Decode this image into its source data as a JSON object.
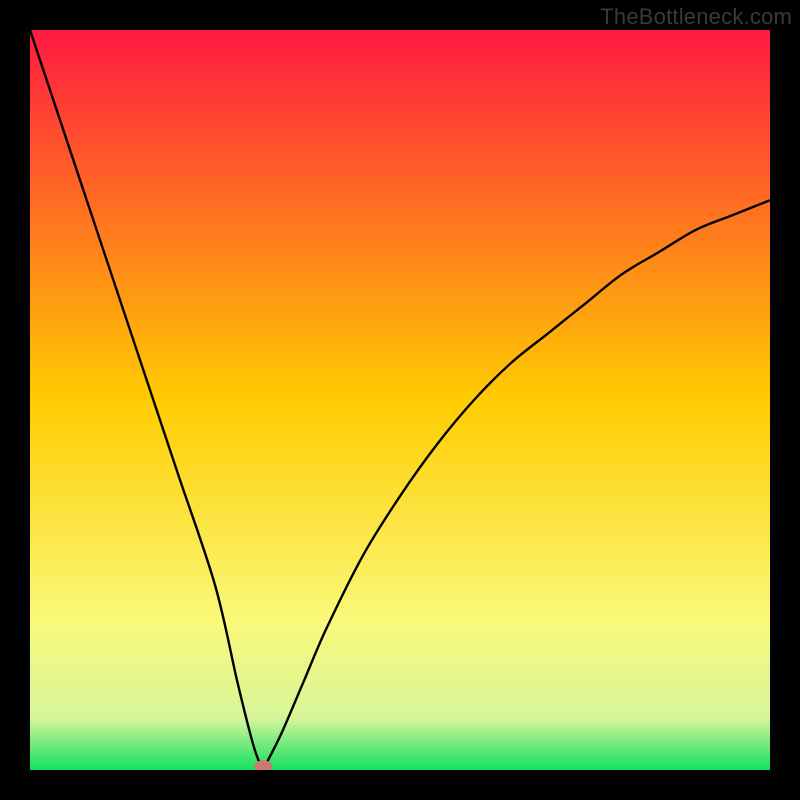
{
  "watermark": "TheBottleneck.com",
  "chart_data": {
    "type": "line",
    "title": "",
    "xlabel": "",
    "ylabel": "",
    "xlim": [
      0,
      100
    ],
    "ylim": [
      0,
      100
    ],
    "grid": false,
    "legend": false,
    "background_gradient": [
      {
        "stop": 0.0,
        "color": "#ff1a40"
      },
      {
        "stop": 0.5,
        "color": "#ffcc00"
      },
      {
        "stop": 0.8,
        "color": "#faf97a"
      },
      {
        "stop": 0.93,
        "color": "#d6f59a"
      },
      {
        "stop": 1.0,
        "color": "#15e060"
      }
    ],
    "series": [
      {
        "name": "bottleneck-curve",
        "x": [
          0,
          2,
          5,
          10,
          15,
          20,
          25,
          28,
          30,
          31,
          31.5,
          32,
          34,
          37,
          40,
          45,
          50,
          55,
          60,
          65,
          70,
          75,
          80,
          85,
          90,
          95,
          100
        ],
        "values": [
          100,
          94,
          85,
          70,
          55,
          40,
          25,
          12,
          4,
          1,
          0,
          1,
          5,
          12,
          19,
          29,
          37,
          44,
          50,
          55,
          59,
          63,
          67,
          70,
          73,
          75,
          77
        ]
      }
    ],
    "marker": {
      "x": 31.5,
      "y": 0.5,
      "color": "#cc7a6e",
      "rx": 9,
      "ry": 6
    }
  }
}
